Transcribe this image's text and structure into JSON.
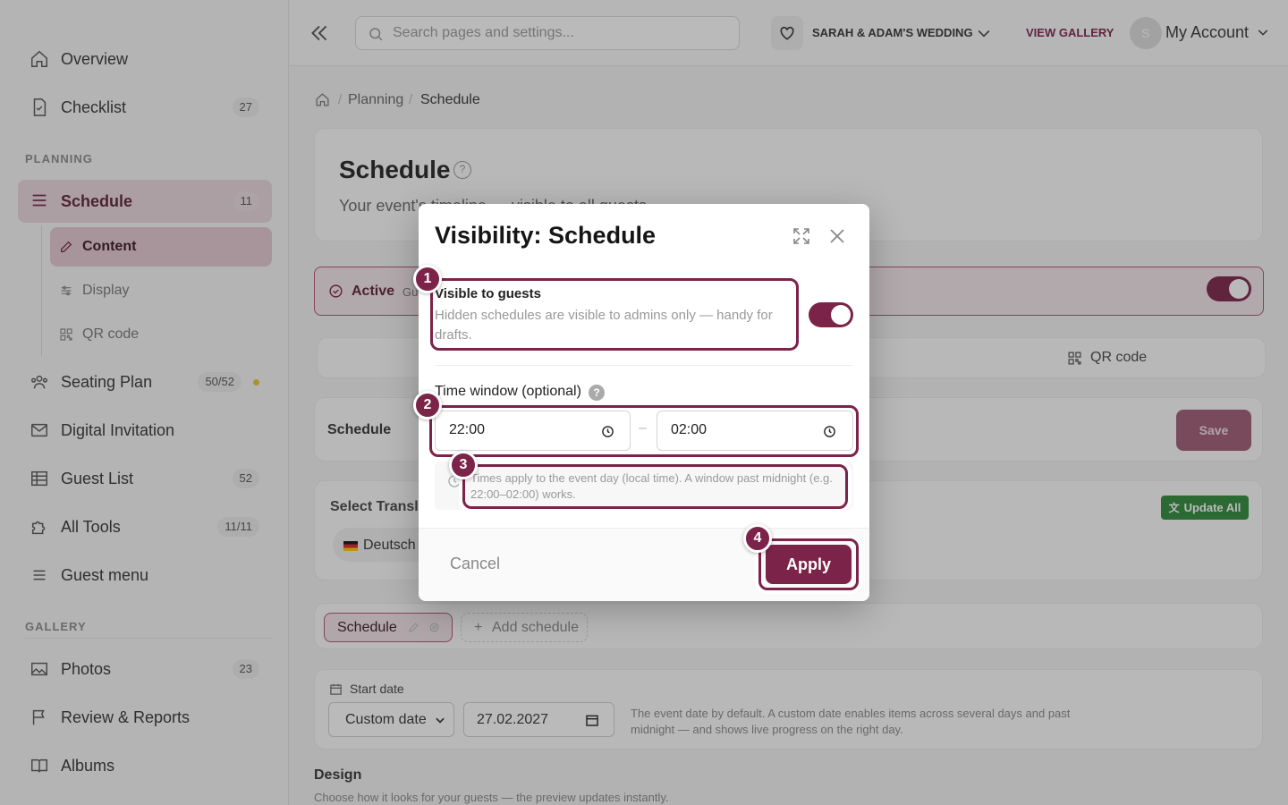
{
  "sidebar": {
    "items": [
      {
        "label": "Overview",
        "icon": "home-icon"
      },
      {
        "label": "Checklist",
        "count": "27",
        "icon": "checklist-icon"
      }
    ],
    "planning_label": "PLANNING",
    "schedule": {
      "label": "Schedule",
      "count": "11"
    },
    "subitems": [
      {
        "label": "Content"
      },
      {
        "label": "Display"
      },
      {
        "label": "QR code"
      }
    ],
    "more_items": [
      {
        "label": "Seating Plan",
        "count": "50/52"
      },
      {
        "label": "Digital Invitation"
      },
      {
        "label": "Guest List",
        "count": "52"
      },
      {
        "label": "All Tools",
        "count": "11/11"
      },
      {
        "label": "Guest menu"
      }
    ],
    "gallery_label": "GALLERY",
    "gallery_items": [
      {
        "label": "Photos",
        "count": "23"
      },
      {
        "label": "Review & Reports"
      },
      {
        "label": "Albums"
      }
    ]
  },
  "topbar": {
    "search_placeholder": "Search pages and settings...",
    "event_name": "SARAH & ADAM'S WEDDING",
    "view_gallery": "VIEW GALLERY",
    "avatar_initial": "S",
    "account": "My Account"
  },
  "breadcrumb": {
    "level1": "Planning",
    "level2": "Schedule"
  },
  "page": {
    "title": "Schedule",
    "subtitle": "Your event's timeline — visible to all guests.",
    "active_label": "Active",
    "active_extra": "Gu",
    "qr_tab": "QR code",
    "schedule_section": "Schedule",
    "save": "Save",
    "select_translation": "Select Transla",
    "update_all": "Update All",
    "language": "Deutsch",
    "schedule_tab": "Schedule",
    "add_schedule": "Add schedule",
    "start_date_label": "Start date",
    "custom_date": "Custom date",
    "date_value": "27.02.2027",
    "date_hint": "The event date by default. A custom date enables items across several days and past midnight — and shows live progress on the right day.",
    "design_label": "Design",
    "design_hint": "Choose how it looks for your guests — the preview updates instantly."
  },
  "modal": {
    "title": "Visibility: Schedule",
    "visible_title": "Visible to guests",
    "visible_desc": "Hidden schedules are visible to admins only — handy for drafts.",
    "toggle_on": true,
    "time_window_label": "Time window (optional)",
    "help_glyph": "?",
    "start_time": "22:00",
    "dash": "–",
    "end_time": "02:00",
    "times_note": "Times apply to the event day (local time). A window past midnight (e.g. 22:00–02:00) works.",
    "cancel": "Cancel",
    "apply": "Apply"
  },
  "badges": [
    "1",
    "2",
    "3",
    "4"
  ],
  "colors": {
    "accent": "#7b2348",
    "green": "#2f8a3a",
    "active_bg": "#ebd7dd"
  }
}
